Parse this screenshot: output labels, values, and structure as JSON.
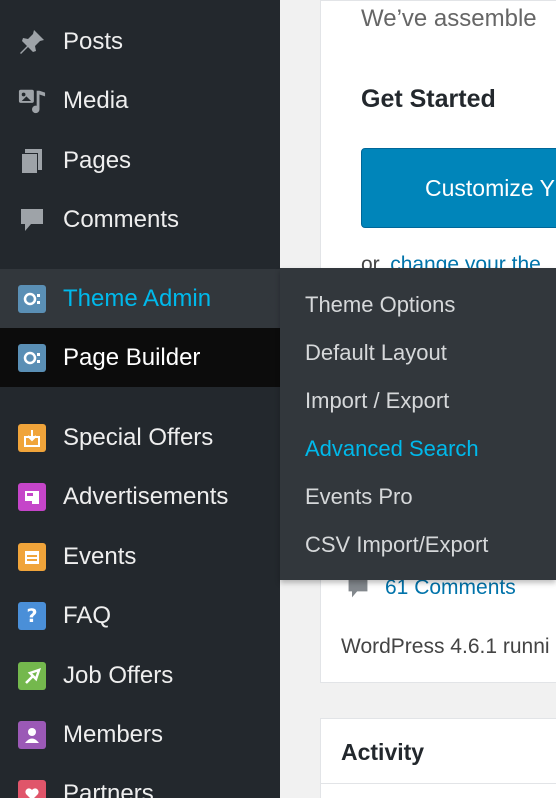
{
  "sidebar": {
    "items": [
      {
        "label": "Posts",
        "icon": "pin-icon"
      },
      {
        "label": "Media",
        "icon": "media-icon"
      },
      {
        "label": "Pages",
        "icon": "pages-icon"
      },
      {
        "label": "Comments",
        "icon": "comment-icon"
      },
      {
        "label": "Theme Admin",
        "icon": "theme-admin-icon"
      },
      {
        "label": "Page Builder",
        "icon": "page-builder-icon"
      },
      {
        "label": "Special Offers",
        "icon": "special-offers-icon",
        "color": "#f0a43a"
      },
      {
        "label": "Advertisements",
        "icon": "advertisements-icon",
        "color": "#c545c9"
      },
      {
        "label": "Events",
        "icon": "events-icon",
        "color": "#f0a43a"
      },
      {
        "label": "FAQ",
        "icon": "faq-icon",
        "color": "#4a8fd8"
      },
      {
        "label": "Job Offers",
        "icon": "job-offers-icon",
        "color": "#74b84d"
      },
      {
        "label": "Members",
        "icon": "members-icon",
        "color": "#9b59b6"
      },
      {
        "label": "Partners",
        "icon": "partners-icon",
        "color": "#e0556a"
      }
    ]
  },
  "flyout": {
    "items": [
      {
        "label": "Theme Options"
      },
      {
        "label": "Default Layout"
      },
      {
        "label": "Import / Export"
      },
      {
        "label": "Advanced Search"
      },
      {
        "label": "Events Pro"
      },
      {
        "label": "CSV Import/Export"
      }
    ]
  },
  "main": {
    "welcome_text": "We’ve assemble",
    "get_started": "Get Started",
    "customize_button": "Customize Y",
    "or_text": "or,",
    "change_theme_link": "change your the",
    "comments_link": "61 Comments",
    "wp_version": "WordPress 4.6.1 runni",
    "activity_title": "Activity"
  },
  "colors": {
    "sidebar_bg": "#23282d",
    "flyout_bg": "#32373c",
    "accent": "#00b9eb",
    "button_blue": "#0085ba"
  }
}
